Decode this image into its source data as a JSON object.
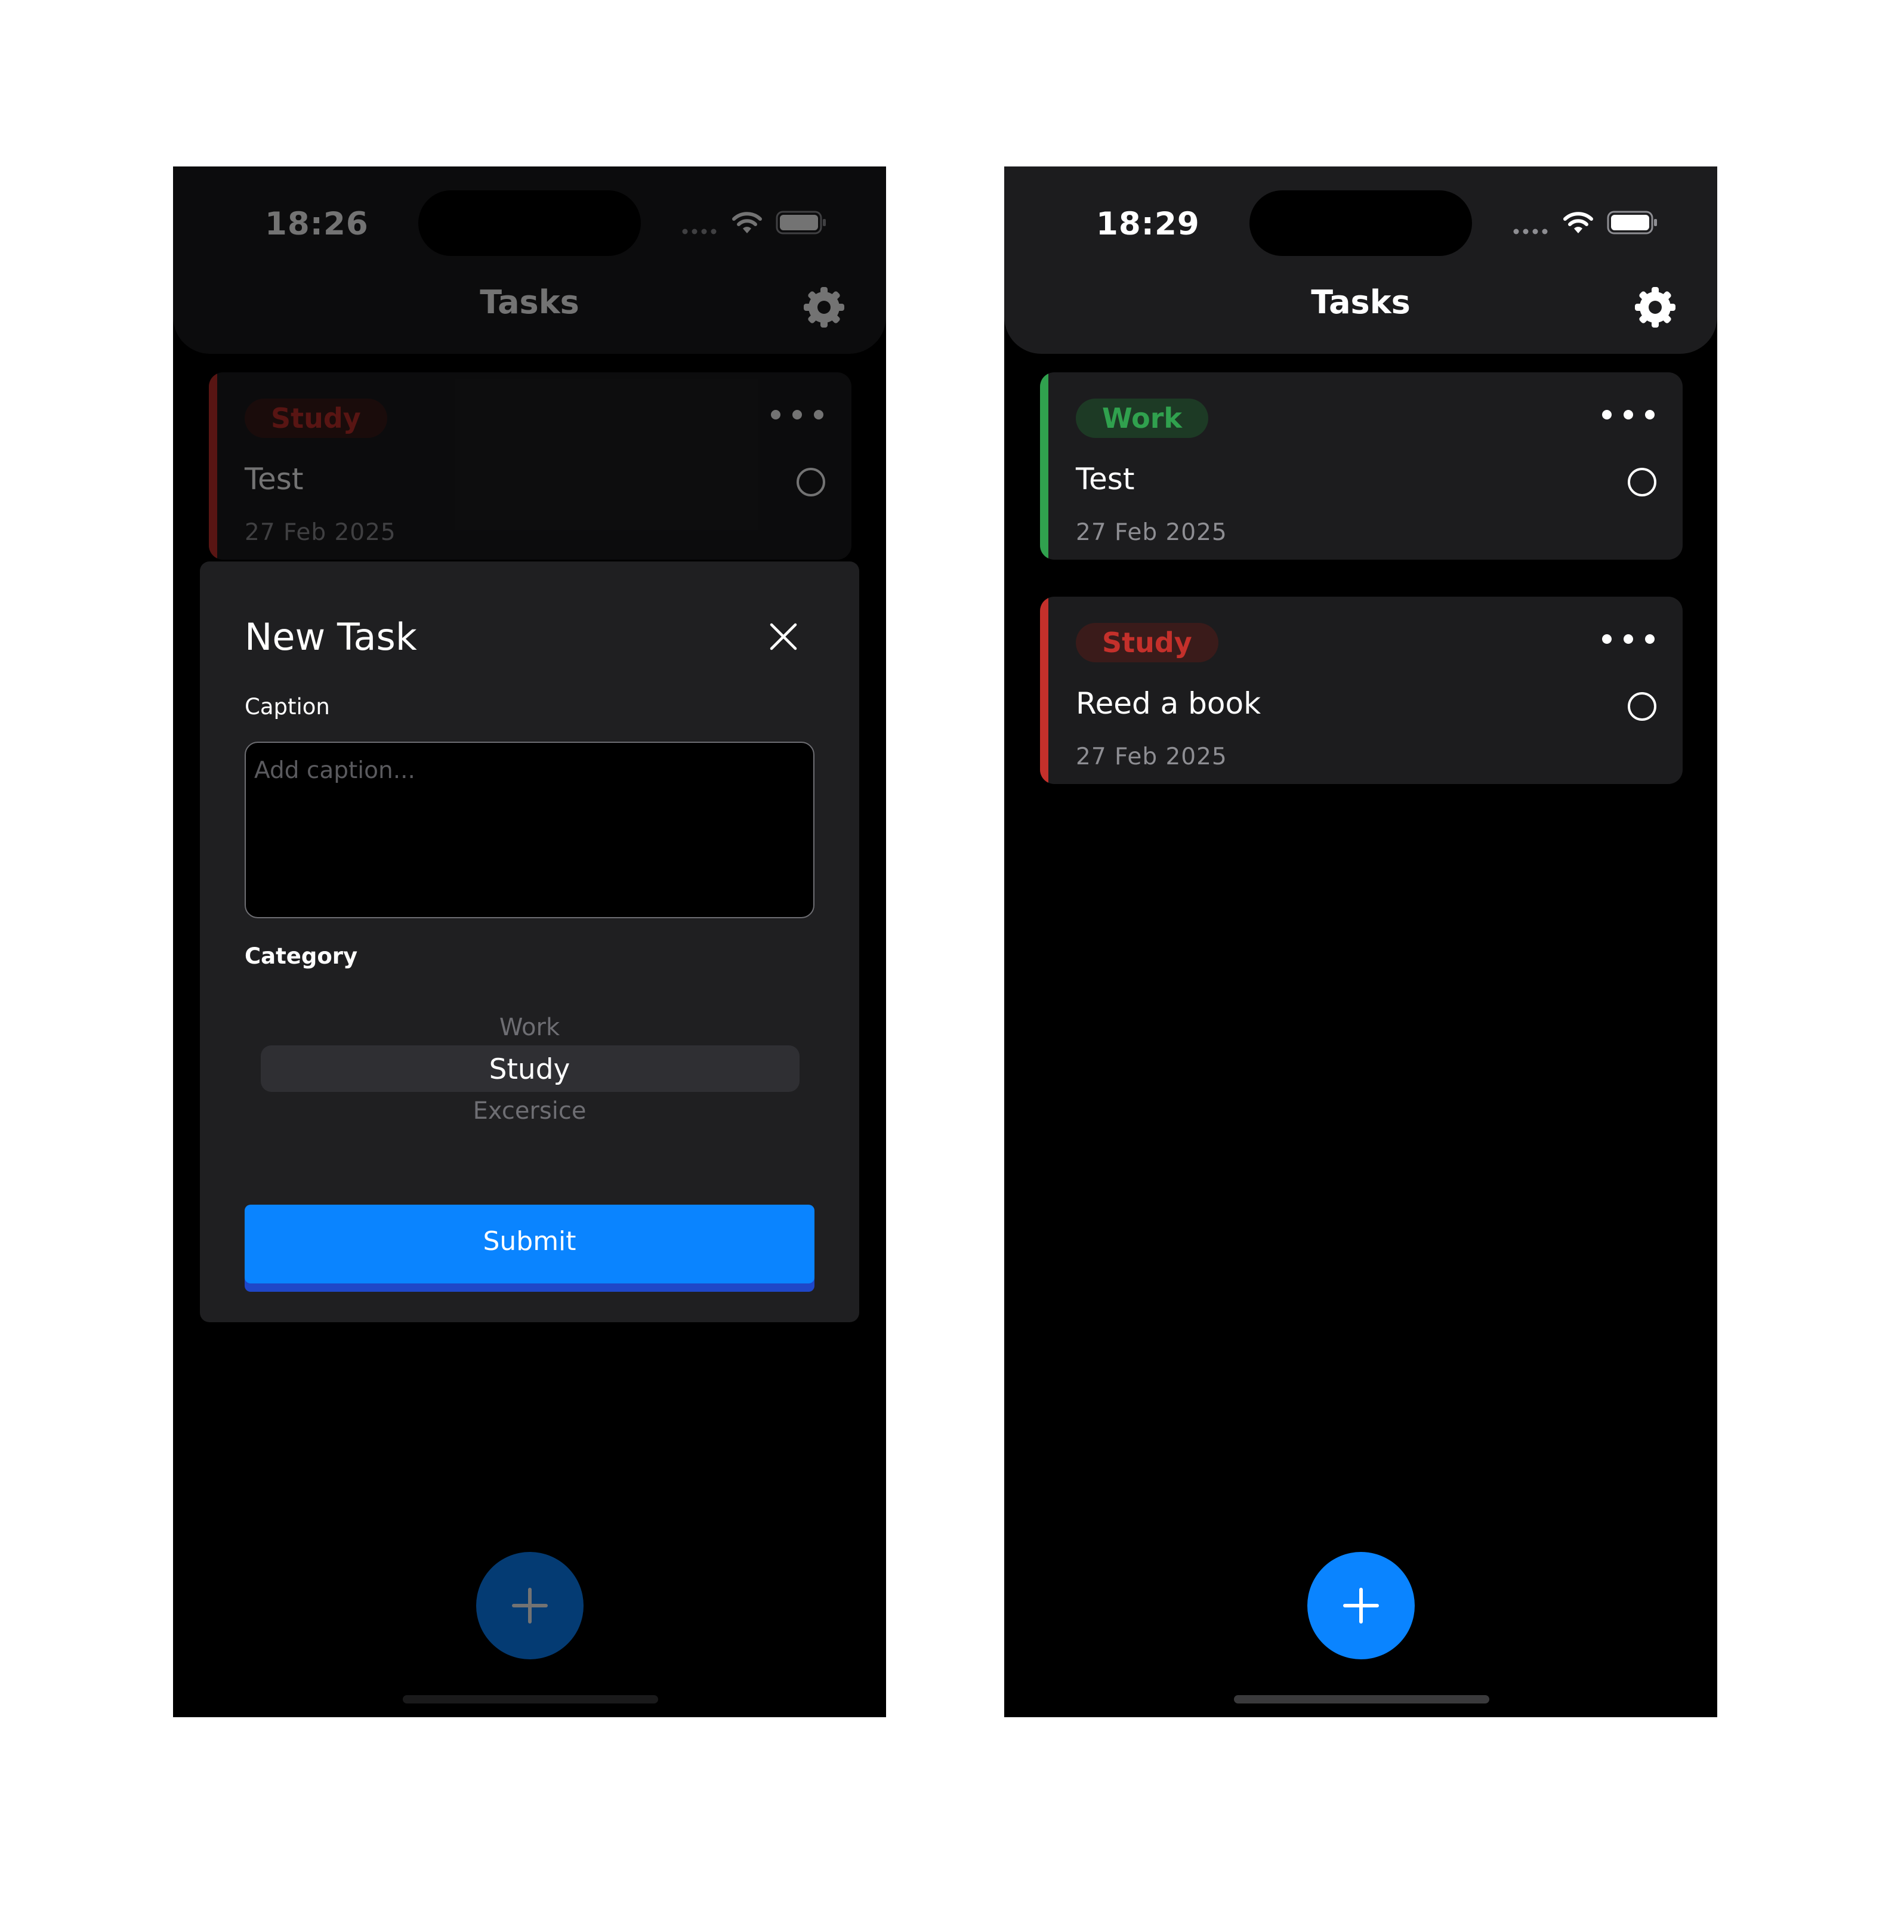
{
  "colors": {
    "accent": "#0a84ff",
    "work": "#30a14e",
    "work_badge_bg": "#1d3a25",
    "study": "#c4302b",
    "study_badge_bg": "#3a1b1a",
    "background": "#000000",
    "surface": "#1c1c1e"
  },
  "left_screen": {
    "status": {
      "time": "18:26"
    },
    "header": {
      "title": "Tasks",
      "settings_icon": "gear-icon"
    },
    "tasks": [
      {
        "category": "Study",
        "caption": "Test",
        "date": "27 Feb 2025"
      }
    ],
    "new_task_sheet": {
      "title": "New Task",
      "caption_label": "Caption",
      "caption_placeholder": "Add caption...",
      "caption_value": "",
      "category_label": "Category",
      "category_options": [
        "Work",
        "Study",
        "Excersice"
      ],
      "category_selected": "Study",
      "submit_label": "Submit"
    },
    "fab_icon": "plus-icon"
  },
  "right_screen": {
    "status": {
      "time": "18:29"
    },
    "header": {
      "title": "Tasks",
      "settings_icon": "gear-icon"
    },
    "tasks": [
      {
        "category": "Work",
        "caption": "Test",
        "date": "27 Feb 2025"
      },
      {
        "category": "Study",
        "caption": "Reed a book",
        "date": "27 Feb 2025"
      }
    ],
    "fab_icon": "plus-icon"
  }
}
